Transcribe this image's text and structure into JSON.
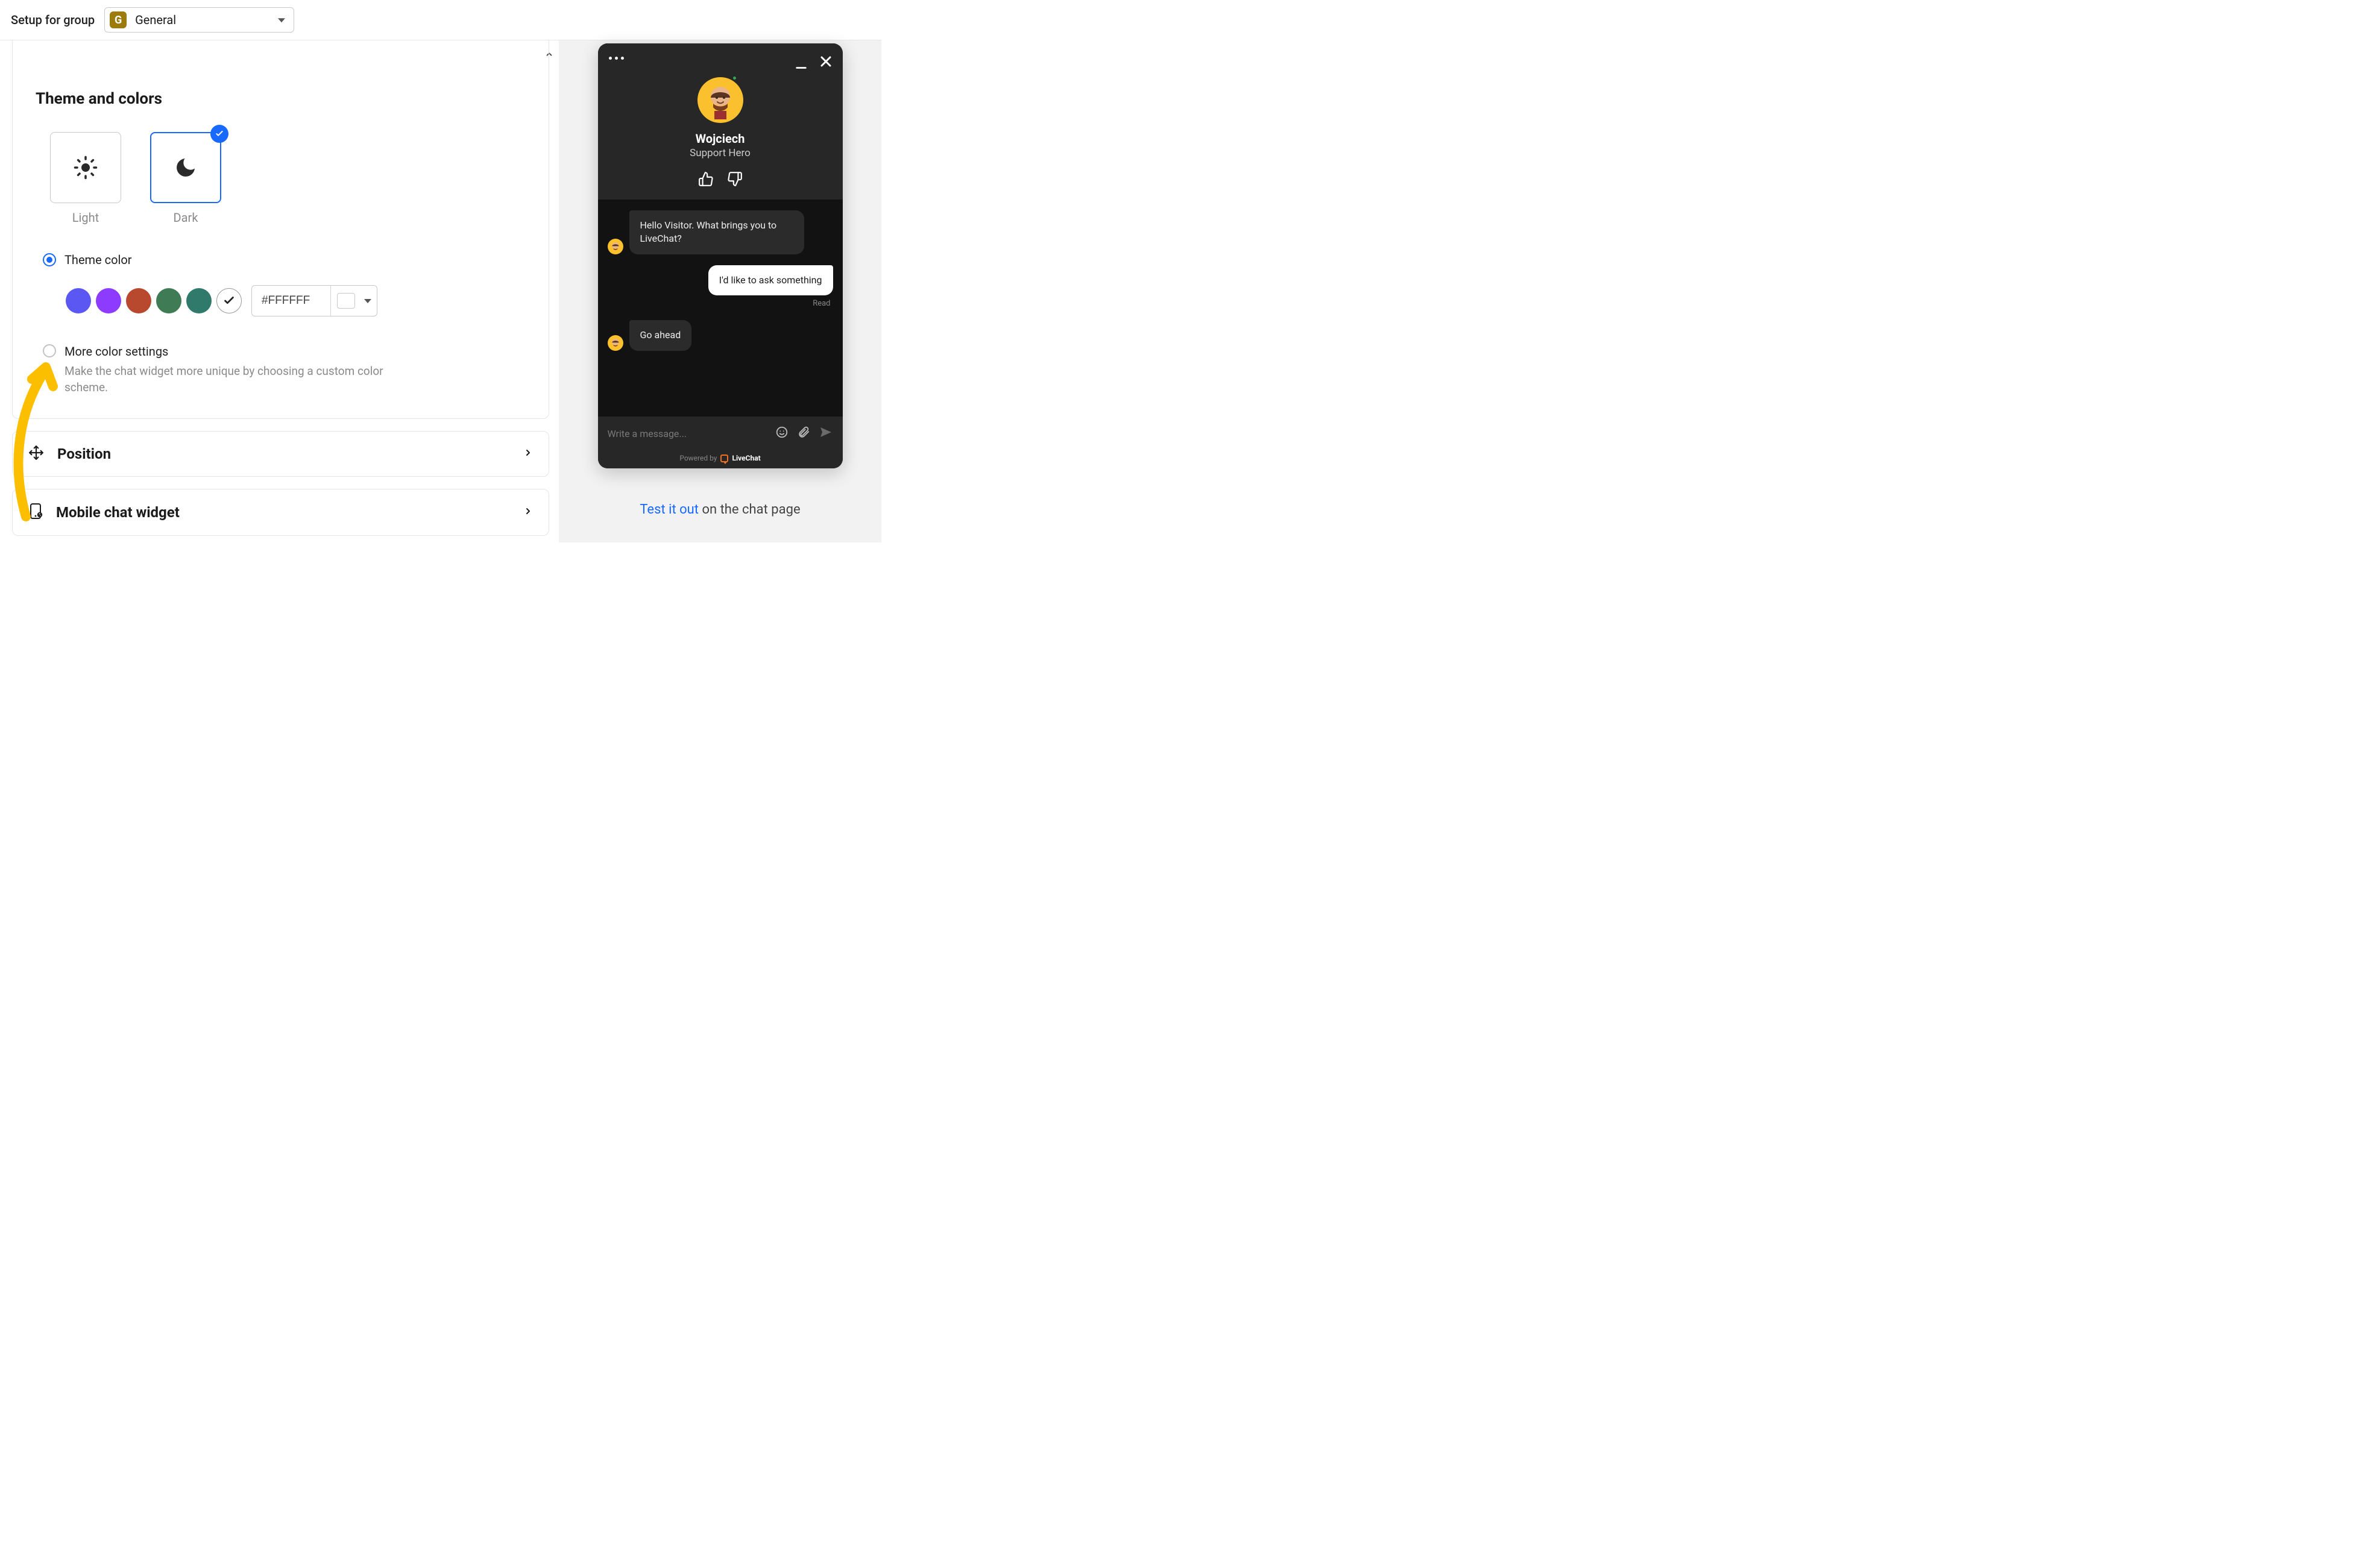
{
  "header": {
    "label": "Setup for group",
    "group_badge": "G",
    "group_name": "General"
  },
  "theme": {
    "section_title": "Theme and colors",
    "light_label": "Light",
    "dark_label": "Dark",
    "selected": "dark",
    "theme_color_label": "Theme color",
    "swatches": [
      "#5b57f2",
      "#8c3bff",
      "#b8492e",
      "#3f7b54",
      "#2f7a6b"
    ],
    "custom_hex": "#FFFFFF",
    "more_title": "More color settings",
    "more_desc": "Make the chat widget more unique by choosing a custom color scheme."
  },
  "rows": {
    "position": "Position",
    "mobile": "Mobile chat widget"
  },
  "chat": {
    "agent_name": "Wojciech",
    "agent_role": "Support Hero",
    "messages": [
      {
        "from": "agent",
        "text": "Hello Visitor. What brings you to LiveChat?"
      },
      {
        "from": "visitor",
        "text": "I'd like to ask something"
      },
      {
        "from": "agent",
        "text": "Go ahead"
      }
    ],
    "read_label": "Read",
    "input_placeholder": "Write a message...",
    "powered_by": "Powered by",
    "brand": "LiveChat"
  },
  "cta": {
    "link": "Test it out",
    "rest": " on the chat page"
  }
}
